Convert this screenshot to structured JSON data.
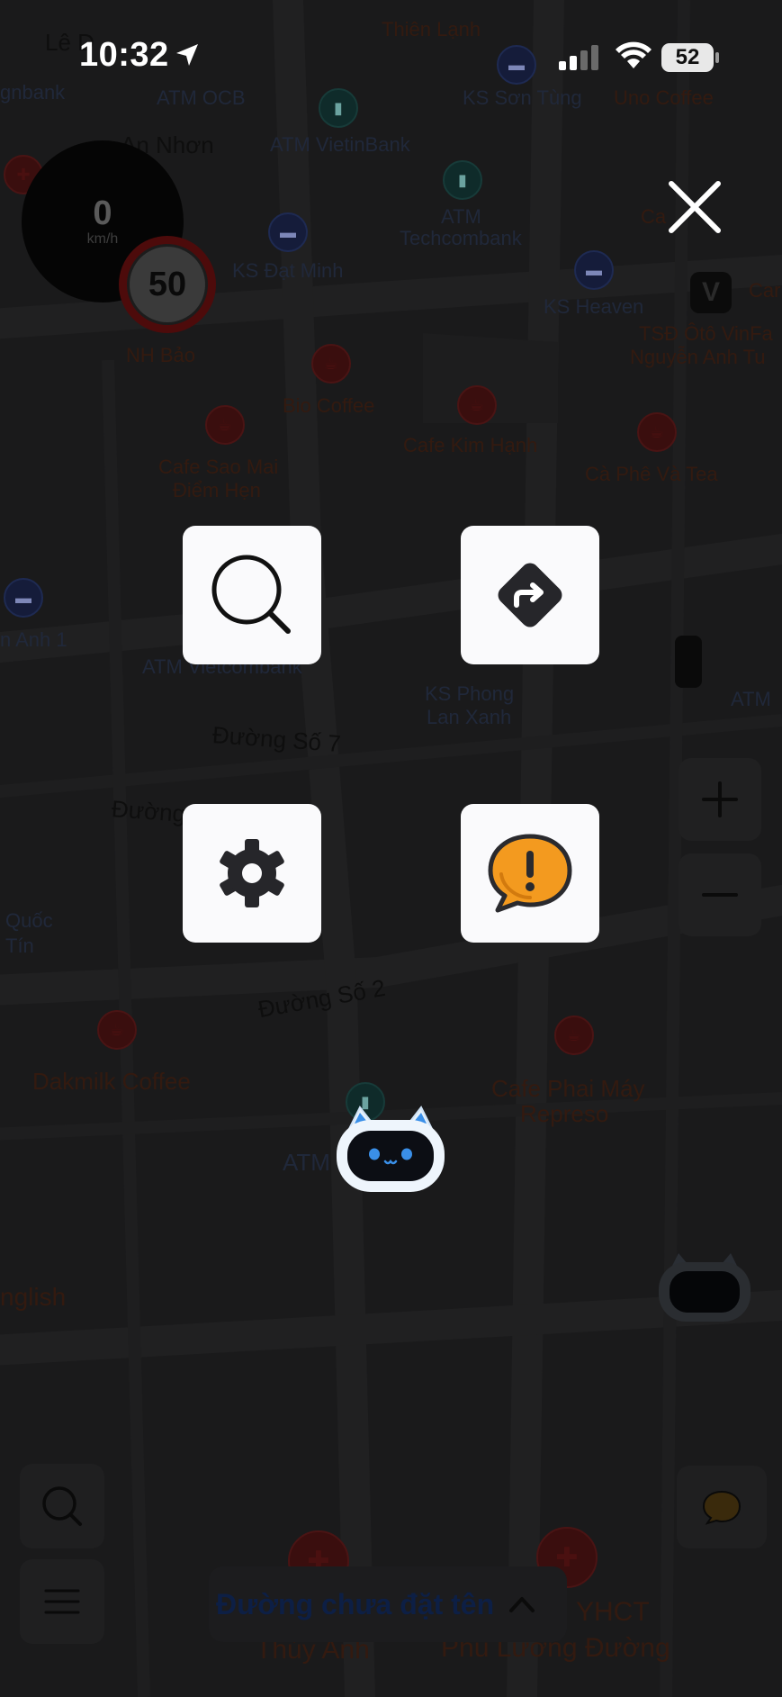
{
  "status_bar": {
    "time": "10:32",
    "battery": "52"
  },
  "speedometer": {
    "speed": "0",
    "unit": "km/h",
    "speed_limit": "50"
  },
  "map_labels": {
    "thien_lanh": "Thiên Lạnh",
    "le": "Lê D",
    "gnbank": "gnbank",
    "atm_ocb": "ATM OCB",
    "ks_son_tung": "KS Sơn Tùng",
    "uno_coffee": "Uno Coffee",
    "an_nhon": "An Nhơn",
    "atm_vietinbank": "ATM VietinBank",
    "atm_techcombank_1": "ATM",
    "atm_techcombank_2": "Techcombank",
    "ks_dat_minh": "KS Đạt Minh",
    "ks_heaven": "KS Heaven",
    "ca": "Ca",
    "car": "Car",
    "tsd_1": "TSĐ Ôtô VinFa",
    "tsd_2": "Nguyễn Anh Tu",
    "nh_bao": "NH Bảo",
    "bio_coffee": "Bio Coffee",
    "cafe_kim_hanh": "Cafe Kim Hạnh",
    "cafe_sao_mai_1": "Cafe Sao Mai",
    "cafe_sao_mai_2": "Điểm Hẹn",
    "ca_phe_va_tea": "Cà Phê Và Tea",
    "anh_1": "n Anh 1",
    "atm_vietcombank": "ATM Vietcombank",
    "ks_phong_lan_1": "KS Phong",
    "ks_phong_lan_2": "Lan Xanh",
    "atm_right": "ATM",
    "duong_so_7": "Đường Số 7",
    "duong": "Đường",
    "quoc_1": "Quốc",
    "quoc_2": "Tín",
    "duong_so_2": "Đường Số 2",
    "dakmilk": "Dakmilk Coffee",
    "cafe_phai_may_1": "Cafe Phai Máy",
    "cafe_phai_may_2": "Represo",
    "atm_bottom": "ATM",
    "english": "nglish",
    "thuy_anh": "Thủy Anh",
    "phu_luong": "Phú Lương Đường",
    "yhct": "YHCT"
  },
  "menu": {
    "close_icon": "close-icon",
    "items": [
      {
        "name": "search",
        "icon": "search-icon"
      },
      {
        "name": "route",
        "icon": "directions-icon"
      },
      {
        "name": "settings",
        "icon": "gear-icon"
      },
      {
        "name": "report",
        "icon": "report-icon"
      }
    ]
  },
  "assistant": {
    "icon": "cat-robot-mascot-icon"
  },
  "bottom": {
    "street_name": "Đường chưa đặt tên"
  },
  "colors": {
    "overlay": "#1a1a1b",
    "tile_bg": "#fafafc",
    "report_orange": "#f39a1f",
    "mascot_blue": "#3a8fe8"
  }
}
